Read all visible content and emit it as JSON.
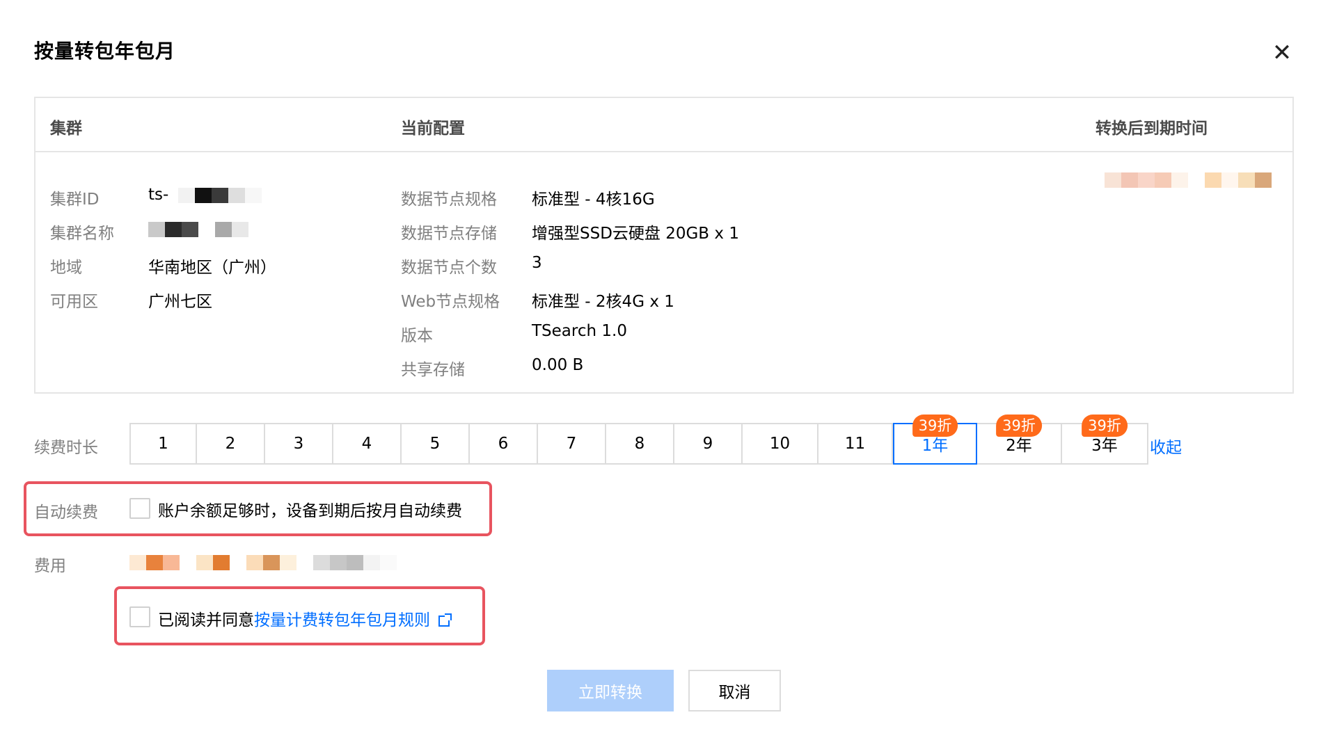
{
  "dialog": {
    "title": "按量转包年包月",
    "close_icon": "close-icon"
  },
  "info_table": {
    "headers": {
      "cluster": "集群",
      "config": "当前配置",
      "expire": "转换后到期时间"
    },
    "cluster": [
      {
        "key": "集群ID",
        "value": "ts-"
      },
      {
        "key": "集群名称",
        "value": ""
      },
      {
        "key": "地域",
        "value": "华南地区（广州）"
      },
      {
        "key": "可用区",
        "value": "广州七区"
      }
    ],
    "config": [
      {
        "key": "数据节点规格",
        "value": "标准型 - 4核16G"
      },
      {
        "key": "数据节点存储",
        "value": "增强型SSD云硬盘 20GB x 1"
      },
      {
        "key": "数据节点个数",
        "value": "3"
      },
      {
        "key": "Web节点规格",
        "value": "标准型 - 2核4G x 1"
      },
      {
        "key": "版本",
        "value": "TSearch 1.0"
      },
      {
        "key": "共享存储",
        "value": "0.00 B"
      }
    ]
  },
  "renewal": {
    "label": "续费时长",
    "options": [
      {
        "label": "1"
      },
      {
        "label": "2"
      },
      {
        "label": "3"
      },
      {
        "label": "4"
      },
      {
        "label": "5"
      },
      {
        "label": "6"
      },
      {
        "label": "7"
      },
      {
        "label": "8"
      },
      {
        "label": "9"
      },
      {
        "label": "10"
      },
      {
        "label": "11"
      },
      {
        "label": "1年",
        "badge": "39折"
      },
      {
        "label": "2年",
        "badge": "39折"
      },
      {
        "label": "3年",
        "badge": "39折"
      }
    ],
    "selected": "1年",
    "collapse_label": "收起"
  },
  "auto_renew": {
    "label": "自动续费",
    "checkbox_text": "账户余额足够时，设备到期后按月自动续费",
    "checked": false
  },
  "fee": {
    "label": "费用"
  },
  "agreement": {
    "text": "已阅读并同意",
    "link_text": "按量计费转包年包月规则",
    "checked": false
  },
  "buttons": {
    "confirm": "立即转换",
    "cancel": "取消"
  },
  "colors": {
    "accent": "#006eff",
    "badge": "#ff6a1a",
    "disabled_button": "#aecffb",
    "highlight_box": "#e8545f"
  }
}
